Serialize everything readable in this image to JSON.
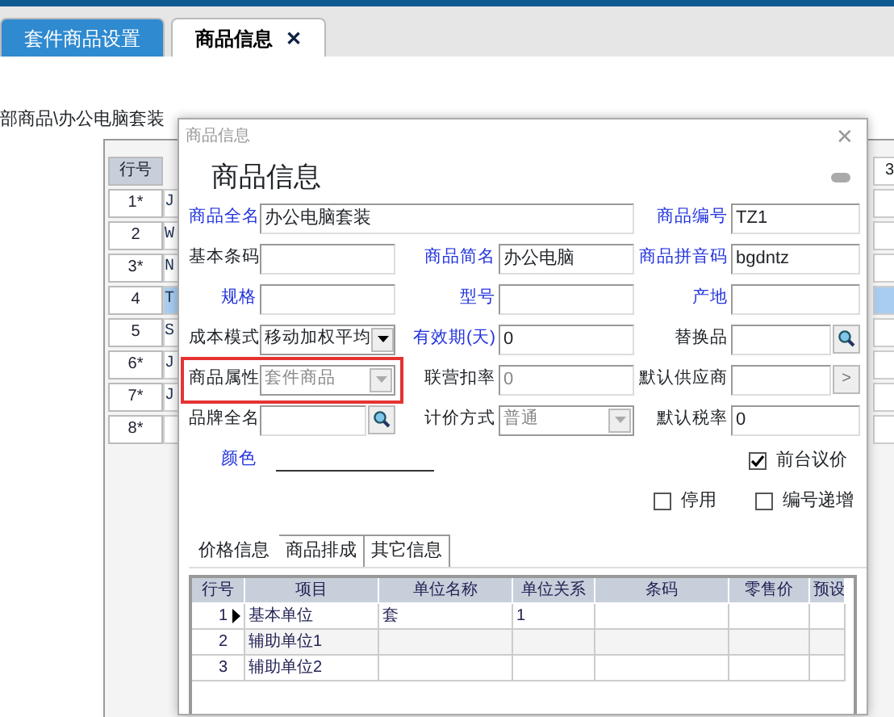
{
  "tabs": [
    {
      "label": "套件商品设置",
      "selected": false
    },
    {
      "label": "商品信息",
      "selected": true,
      "close": "✕"
    }
  ],
  "breadcrumb": "部商品\\办公电脑套装",
  "background_grid": {
    "header": "行号",
    "right_header": "3",
    "rows": [
      {
        "row": "1*",
        "code": "J",
        "current": false
      },
      {
        "row": "2",
        "code": "W",
        "current": false
      },
      {
        "row": "3*",
        "code": "N",
        "current": false
      },
      {
        "row": "4",
        "code": "T",
        "current": true
      },
      {
        "row": "5",
        "code": "S",
        "current": false
      },
      {
        "row": "6*",
        "code": "J",
        "current": false
      },
      {
        "row": "7*",
        "code": "J",
        "current": false
      },
      {
        "row": "8*",
        "current": false
      }
    ]
  },
  "dialog": {
    "title": "商品信息",
    "close": "✕",
    "heading": "商品信息",
    "fields": [
      {
        "label": "商品全名",
        "required": true,
        "kind": "input",
        "value": "办公电脑套装"
      },
      {
        "label": "商品编号",
        "required": true,
        "kind": "input",
        "value": "TZ1"
      },
      {
        "label": "基本条码",
        "required": false,
        "kind": "input"
      },
      {
        "label": "商品简名",
        "required": true,
        "kind": "input",
        "value": "办公电脑"
      },
      {
        "label": "商品拼音码",
        "required": true,
        "kind": "input",
        "value": "bgdntz"
      },
      {
        "label": "规格",
        "required": true,
        "kind": "input"
      },
      {
        "label": "型号",
        "required": true,
        "kind": "input"
      },
      {
        "label": "产地",
        "required": true,
        "kind": "input"
      },
      {
        "label": "成本模式",
        "required": false,
        "kind": "select",
        "value": "移动加权平均",
        "disabled": false
      },
      {
        "label": "有效期(天)",
        "required": true,
        "kind": "input",
        "value": "0"
      },
      {
        "label": "替换品",
        "required": false,
        "kind": "lookup"
      },
      {
        "label": "商品属性",
        "required": false,
        "kind": "select",
        "value": "套件商品",
        "disabled": true,
        "highlighted": true
      },
      {
        "label": "联营扣率",
        "required": false,
        "kind": "input",
        "value": "0",
        "disabled": true
      },
      {
        "label": "默认供应商",
        "required": false,
        "kind": "more",
        "button": ">"
      },
      {
        "label": "品牌全名",
        "required": false,
        "kind": "lookup"
      },
      {
        "label": "计价方式",
        "required": false,
        "kind": "select",
        "value": "普通",
        "disabled": true
      },
      {
        "label": "默认税率",
        "required": false,
        "kind": "input",
        "value": "0"
      }
    ],
    "color_label": "颜色",
    "checkboxes": [
      {
        "label": "前台议价",
        "checked": true
      },
      {
        "label": "停用",
        "checked": false
      },
      {
        "label": "编号递增",
        "checked": false
      }
    ],
    "subtabs": [
      {
        "label": "价格信息",
        "selected": true
      },
      {
        "label": "商品排成",
        "selected": false
      },
      {
        "label": "其它信息",
        "selected": false
      }
    ],
    "table": {
      "columns": [
        "行号",
        "项目",
        "单位名称",
        "单位关系",
        "条码",
        "零售价",
        "预设"
      ],
      "rows": [
        {
          "cells": [
            "1",
            "基本单位",
            "套",
            "1",
            null,
            null,
            null
          ],
          "current": true
        },
        {
          "cells": [
            "2",
            "辅助单位1",
            null,
            null,
            null,
            null,
            null
          ],
          "current": false
        },
        {
          "cells": [
            "3",
            "辅助单位2",
            null,
            null,
            null,
            null,
            null
          ],
          "current": false
        }
      ]
    }
  }
}
